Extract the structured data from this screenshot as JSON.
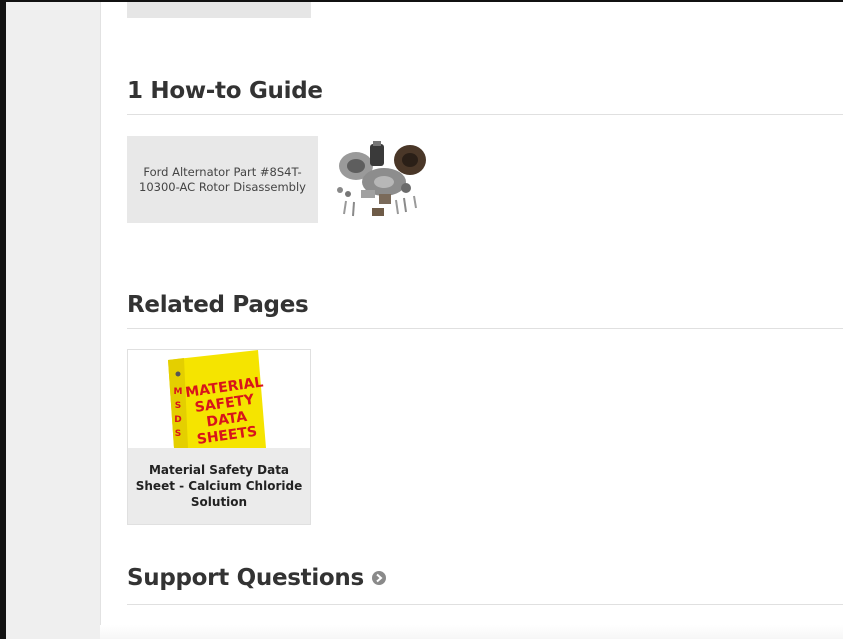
{
  "sections": {
    "guides": {
      "title": "1 How-to Guide"
    },
    "related": {
      "title": "Related Pages"
    },
    "support": {
      "title": "Support Questions"
    }
  },
  "guide": {
    "title": "Ford Alternator Part #8S4T-10300-AC Rotor Disassembly"
  },
  "related_page": {
    "title": "Material Safety Data Sheet - Calcium Chloride Solution",
    "binder_cover": "MATERIAL SAFETY DATA SHEETS",
    "binder_spine": "MSDS",
    "binder_color": "#f5e400",
    "text_color": "#d8141b"
  }
}
